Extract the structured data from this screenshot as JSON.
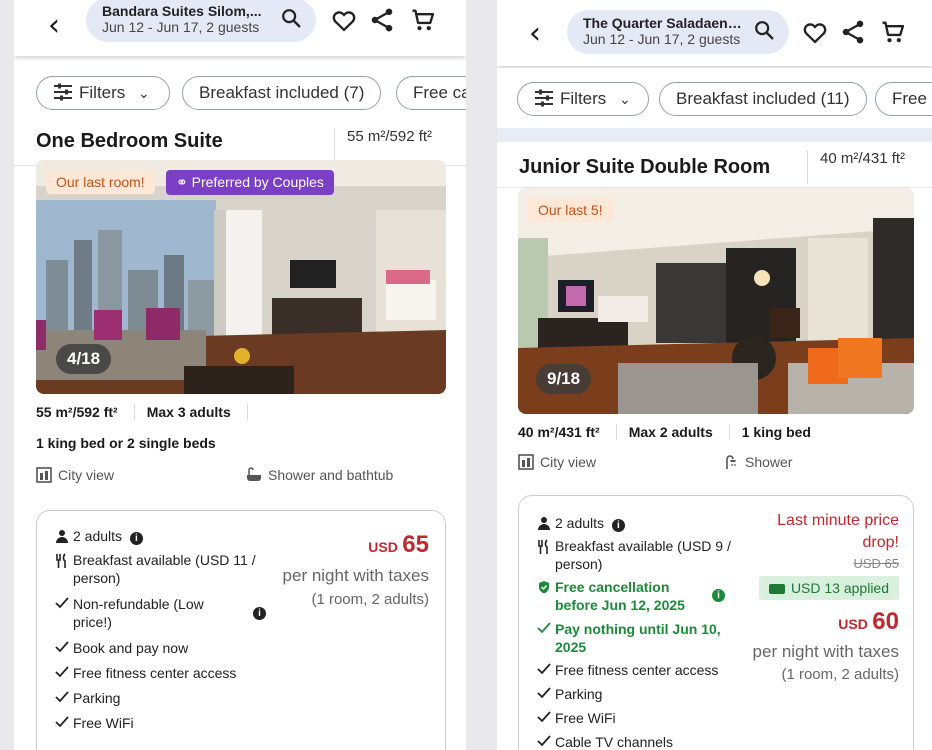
{
  "left": {
    "header": {
      "hotel_name": "Bandara Suites Silom,...",
      "dates_guests": "Jun 12 - Jun 17, 2 guests"
    },
    "filters": {
      "filters_label": "Filters",
      "chip1": "Breakfast included (7)",
      "chip2": "Free ca"
    },
    "room": {
      "name": "One Bedroom Suite",
      "size": "55 m²/592 ft²",
      "badge1": "Our last room!",
      "badge2": "Preferred by Couples",
      "photo_counter": "4/18",
      "fact_size": "55 m²/592 ft²",
      "fact_max": "Max 3 adults",
      "beds": "1 king bed or 2 single beds",
      "amenity1": "City view",
      "amenity2": "Shower and bathtub"
    },
    "offer": {
      "guests": "2 adults",
      "breakfast": "Breakfast available (USD 11 / person)",
      "refund": "Non-refundable (Low price!)",
      "payment": "Book and pay now",
      "fitness": "Free fitness center access",
      "parking": "Parking",
      "wifi": "Free WiFi",
      "currency": "USD",
      "price": "65",
      "per_night": "per night with taxes",
      "occupancy": "(1 room, 2 adults)"
    }
  },
  "right": {
    "header": {
      "hotel_name": "The Quarter Saladaeng...",
      "dates_guests": "Jun 12 - Jun 17, 2 guests"
    },
    "filters": {
      "filters_label": "Filters",
      "chip1": "Breakfast included (11)",
      "chip2": "Free"
    },
    "room": {
      "name": "Junior Suite Double Room",
      "size": "40 m²/431 ft²",
      "badge1": "Our last 5!",
      "photo_counter": "9/18",
      "fact_size": "40 m²/431 ft²",
      "fact_max": "Max 2 adults",
      "fact_bed": "1 king bed",
      "amenity1": "City view",
      "amenity2": "Shower"
    },
    "offer": {
      "guests": "2 adults",
      "breakfast": "Breakfast available (USD 9 / person)",
      "cancellation": "Free cancellation before Jun 12, 2025",
      "pay_nothing": "Pay nothing until Jun 10, 2025",
      "fitness": "Free fitness center access",
      "parking": "Parking",
      "wifi": "Free WiFi",
      "cable": "Cable TV channels",
      "deal_title": "Last minute price drop!",
      "old_price": "USD 65",
      "discount": "USD 13 applied",
      "currency": "USD",
      "price": "60",
      "per_night": "per night with taxes",
      "occupancy": "(1 room, 2 adults)"
    }
  },
  "colors": {
    "price_red": "#c0282e",
    "green": "#1d8a3a",
    "pill_bg": "#e4e9f5",
    "purple_badge": "#7b3fc6"
  }
}
